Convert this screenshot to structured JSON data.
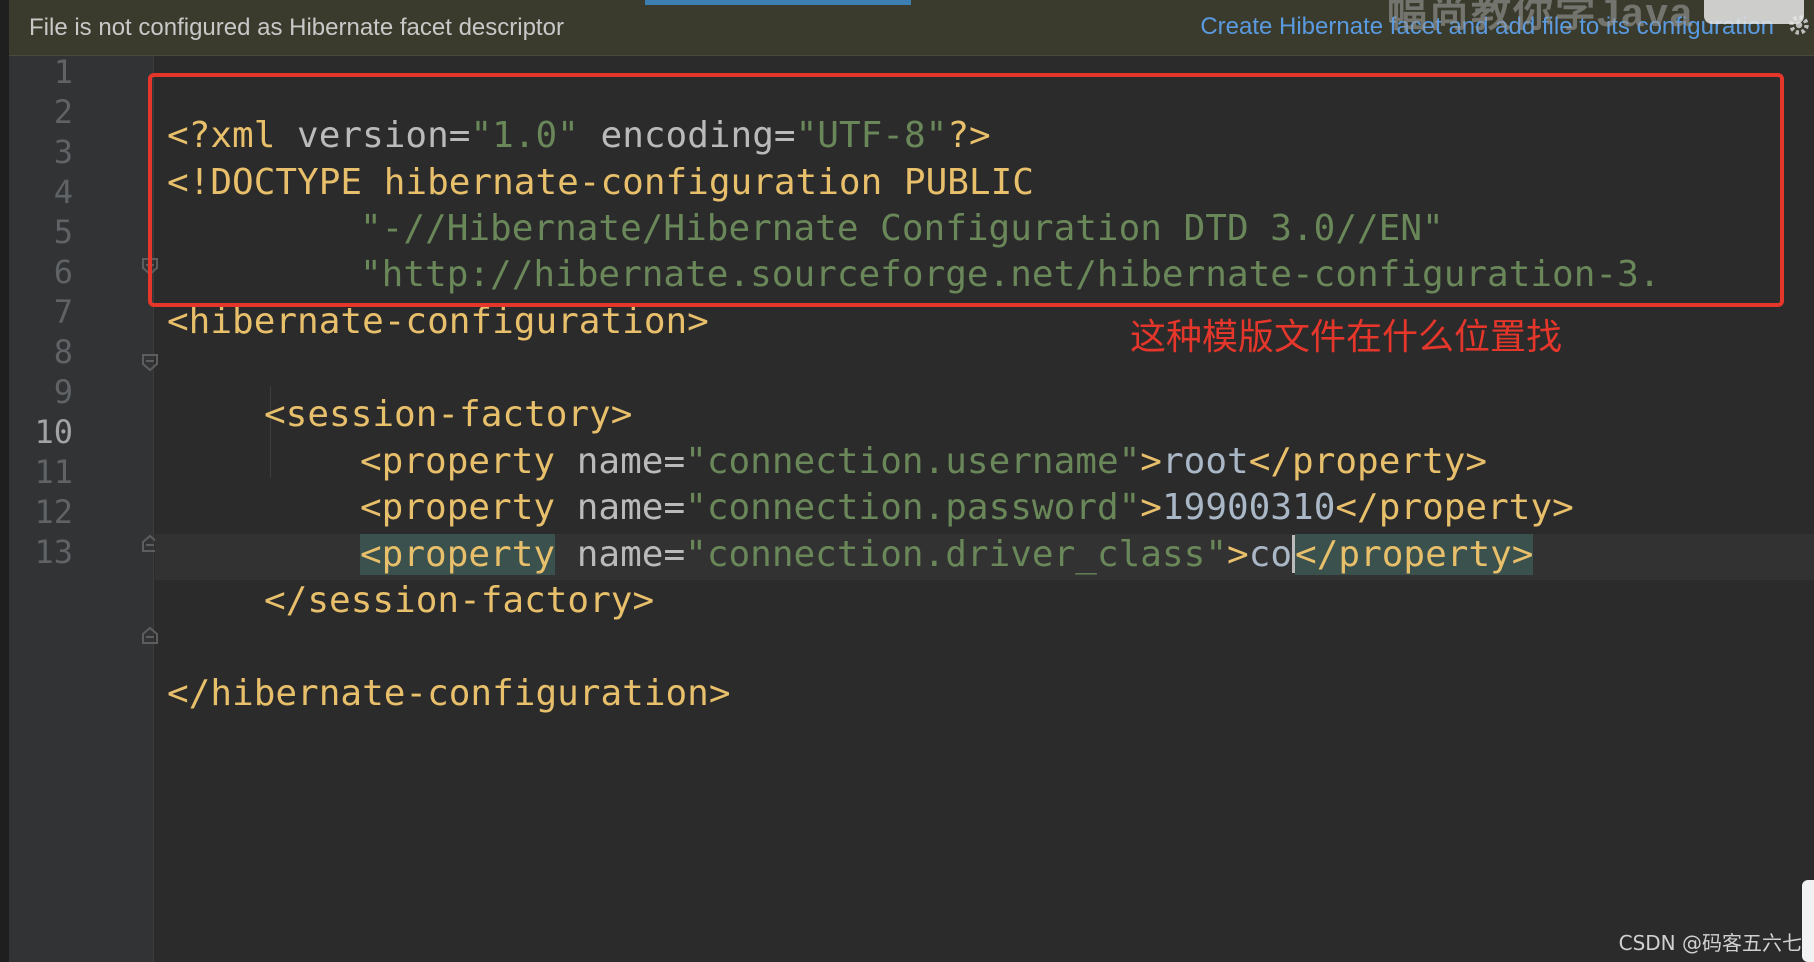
{
  "banner": {
    "message": "File is not configured as Hibernate facet descriptor",
    "action_link": "Create Hibernate facet and add file to its configuration"
  },
  "watermark": {
    "top_text": "幅尚教你学Java"
  },
  "line_numbers": [
    "1",
    "2",
    "3",
    "4",
    "5",
    "6",
    "7",
    "8",
    "9",
    "10",
    "11",
    "12",
    "13"
  ],
  "current_line": "10",
  "code": {
    "l1": {
      "open": "<?xml ",
      "a1": "version",
      "eq1": "=",
      "v1": "\"1.0\"",
      "sp": " ",
      "a2": "encoding",
      "eq2": "=",
      "v2": "\"UTF-8\"",
      "close": "?>"
    },
    "l2": {
      "text": "<!DOCTYPE hibernate-configuration PUBLIC"
    },
    "l3": {
      "text": "\"-//Hibernate/Hibernate Configuration DTD 3.0//EN\""
    },
    "l4": {
      "text": "\"http://hibernate.sourceforge.net/hibernate-configuration-3."
    },
    "l5": {
      "text": "<hibernate-configuration>"
    },
    "l7": {
      "text": "<session-factory>"
    },
    "l8": {
      "open": "<property",
      "attr": " name",
      "eq": "=",
      "val": "\"connection.username\"",
      "gt": ">",
      "content": "root",
      "close": "</property>"
    },
    "l9": {
      "open": "<property",
      "attr": " name",
      "eq": "=",
      "val": "\"connection.password\"",
      "gt": ">",
      "content": "19900310",
      "close": "</property>"
    },
    "l10": {
      "open": "<property",
      "attr": " name",
      "eq": "=",
      "val": "\"connection.driver_class\"",
      "gt": ">",
      "content": "co",
      "close": "</property>"
    },
    "l11": {
      "text": "</session-factory>"
    },
    "l13": {
      "text": "</hibernate-configuration>"
    }
  },
  "annotation": {
    "text": "这种模版文件在什么位置找",
    "color": "#e4362b"
  },
  "credit": "CSDN @码客五六七",
  "colors": {
    "background": "#2b2b2b",
    "tag": "#e8bf6a",
    "string": "#6a8759",
    "link": "#5a9ae0"
  }
}
